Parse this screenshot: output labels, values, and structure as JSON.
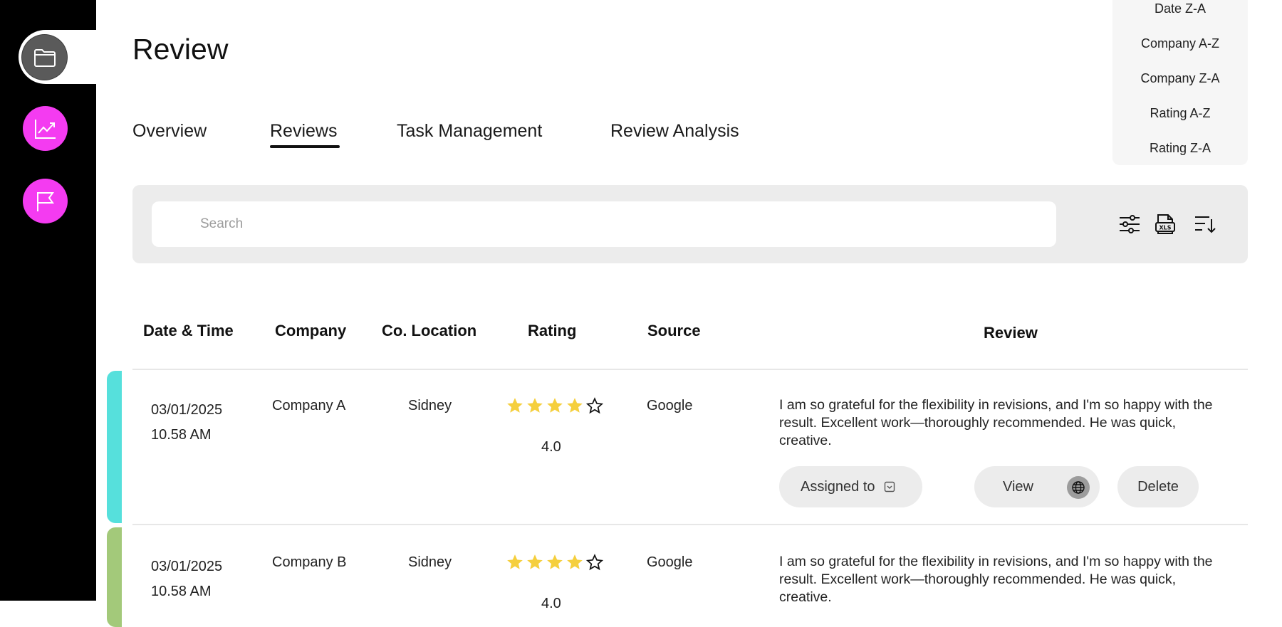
{
  "sidebar": {
    "items": [
      {
        "name": "folder",
        "icon": "folder-icon",
        "active": true
      },
      {
        "name": "analytics",
        "icon": "trending-chart-icon",
        "active": false
      },
      {
        "name": "flags",
        "icon": "flag-icon",
        "active": false
      }
    ],
    "accent_color": "#f43bf1"
  },
  "page": {
    "title": "Review"
  },
  "tabs": [
    {
      "label": "Overview",
      "active": false
    },
    {
      "label": "Reviews",
      "active": true
    },
    {
      "label": "Task Management",
      "active": false
    },
    {
      "label": "Review Analysis",
      "active": false
    }
  ],
  "sort_menu": {
    "options": [
      "Date Z-A",
      "Company A-Z",
      "Company Z-A",
      "Rating A-Z",
      "Rating Z-A"
    ]
  },
  "search": {
    "placeholder": "Search",
    "value": "",
    "tools": [
      "filter-sliders-icon",
      "xls-export-icon",
      "sort-descending-icon"
    ]
  },
  "table": {
    "headers": {
      "date": "Date & Time",
      "company": "Company",
      "location": "Co. Location",
      "rating": "Rating",
      "source": "Source",
      "review": "Review"
    },
    "rows": [
      {
        "date": "03/01/2025",
        "time": "10.58 AM",
        "company": "Company A",
        "location": "Sidney",
        "stars_filled": 4,
        "stars_total": 5,
        "rating": "4.0",
        "source": "Google",
        "review": "I am so grateful for the flexibility in revisions, and I'm so happy with the result. Excellent work—thoroughly recommended. He was quick, creative.",
        "accent": "#56e0dc",
        "assigned_label": "Assigned to",
        "view_label": "View",
        "delete_label": "Delete"
      },
      {
        "date": "03/01/2025",
        "time": "10.58 AM",
        "company": "Company B",
        "location": "Sidney",
        "stars_filled": 4,
        "stars_total": 5,
        "rating": "4.0",
        "source": "Google",
        "review": "I am so grateful for the flexibility in revisions, and I'm so happy with the result. Excellent work—thoroughly recommended. He was quick, creative.",
        "accent": "#a3c97a"
      }
    ]
  },
  "colors": {
    "star": "#f5cf3d",
    "panel_bg": "#ececec"
  }
}
